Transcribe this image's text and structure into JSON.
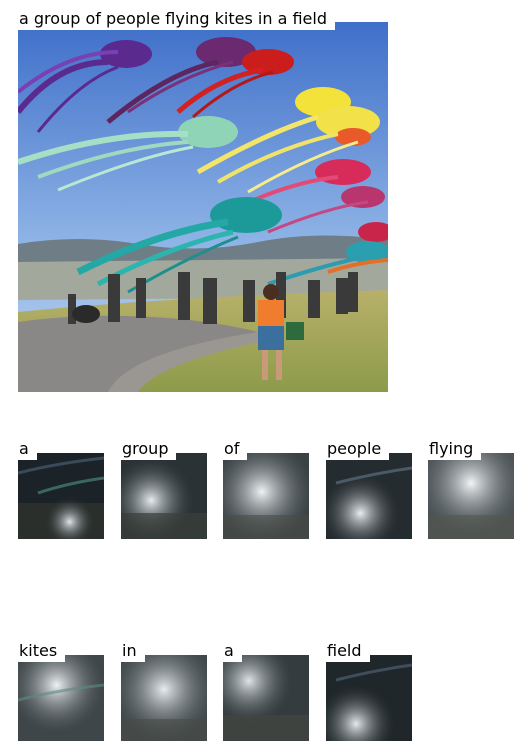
{
  "caption": "a group of people flying kites in a field",
  "attention_words": [
    {
      "word": "a"
    },
    {
      "word": "group"
    },
    {
      "word": "of"
    },
    {
      "word": "people"
    },
    {
      "word": "flying"
    },
    {
      "word": "kites"
    },
    {
      "word": "in"
    },
    {
      "word": "a"
    },
    {
      "word": "field"
    }
  ]
}
